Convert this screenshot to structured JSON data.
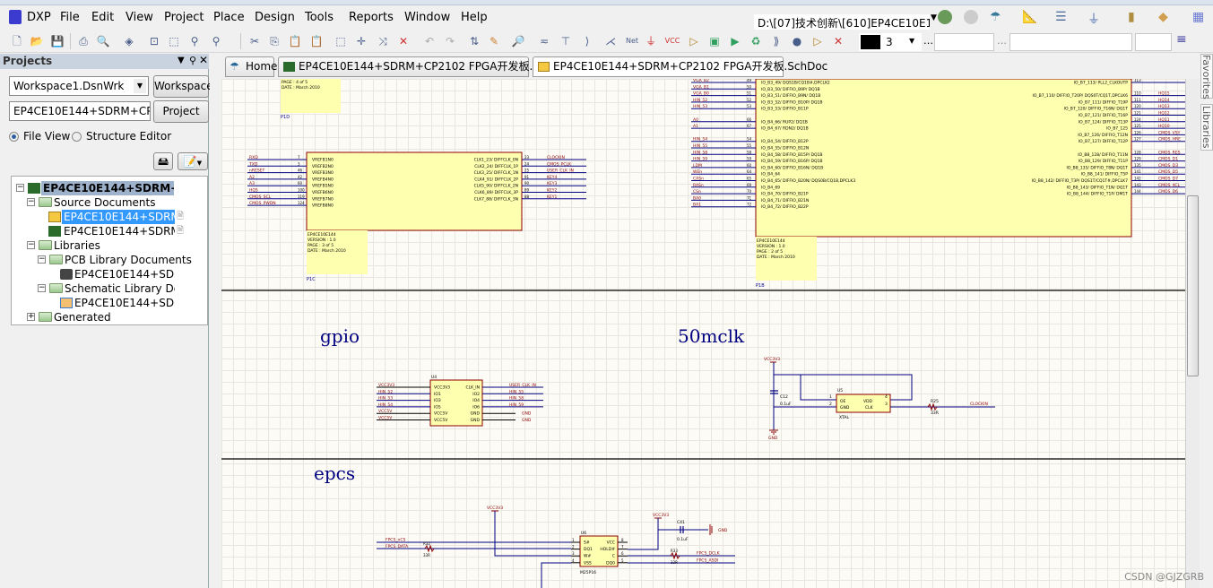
{
  "menu": {
    "logo": "DXP",
    "items": [
      "File",
      "Edit",
      "View",
      "Project",
      "Place",
      "Design",
      "Tools",
      "Reports",
      "Window",
      "Help"
    ]
  },
  "toolbar": {
    "path": "D:\\[07]技术创新\\[610]EP4CE10E1:",
    "line_width": "3",
    "net_label": "Net",
    "vcc_label": "VCC",
    "color": "#000000"
  },
  "panel": {
    "title": "Projects",
    "workspace_value": "Workspace1.DsnWrk",
    "workspace_btn": "Workspace",
    "project_value": "EP4CE10E144+SDRM+CP2102",
    "project_btn": "Project",
    "file_view": "File View",
    "structure_editor": "Structure Editor",
    "tree": {
      "root": "EP4CE10E144+SDRM+CP",
      "source_docs": "Source Documents",
      "sch_doc": "EP4CE10E144+SDRM+C",
      "pcb_doc": "EP4CE10E144+SDRM+C",
      "libraries": "Libraries",
      "pcb_lib_docs": "PCB Library Documents",
      "pcb_lib": "EP4CE10E144+SDRM",
      "sch_lib_docs": "Schematic Library Docum",
      "sch_lib": "EP4CE10E144+SDRM",
      "generated": "Generated"
    }
  },
  "tabs": [
    {
      "label": "Home"
    },
    {
      "label": "EP4CE10E144+SDRM+CP2102 FPGA开发板.PcbDoc"
    },
    {
      "label": "EP4CE10E144+SDRM+CP2102 FPGA开发板.SchDoc"
    }
  ],
  "right_panels": [
    "Favorites",
    "Libraries"
  ],
  "watermark": "CSDN @GJZGRB",
  "schematic": {
    "sections": {
      "gpio": "gpio",
      "mclk": "50mclk",
      "epcs": "epcs"
    },
    "p1d": {
      "page": "PAGE : 4 of 5",
      "date": "DATE : March 2010",
      "ref": "P1D"
    },
    "p1c": {
      "ref": "P1C",
      "title": [
        "EP4CE10E144",
        "VERSION : 1.0",
        "PAGE : 3 of 5",
        "DATE : March 2010"
      ],
      "left": [
        [
          "RXD",
          "7",
          "VREFB1N0"
        ],
        [
          "TXD",
          "3",
          "VREFB2N0"
        ],
        [
          "nRESET",
          "46",
          "VREFB3N0"
        ],
        [
          "A2",
          "42",
          "VREFB4N0"
        ],
        [
          "A3",
          "60",
          "VREFB5N0"
        ],
        [
          "HQ5",
          "100",
          "VREFB6N0"
        ],
        [
          "CMOS_SCL",
          "119",
          "VREFB7N0"
        ],
        [
          "CMOS_PWDN",
          "124",
          "VREFB8N0"
        ]
      ],
      "right": [
        [
          "CLOCKIN",
          "23",
          "CLK1_23/  DIFFCLK_0N"
        ],
        [
          "CMOS_PCLK",
          "24",
          "CLK2_24/  DIFFCLK_1P"
        ],
        [
          "USER_CLK_IN",
          "25",
          "CLK3_25/  DIFFCLK_1N"
        ],
        [
          "KEY4",
          "91",
          "CLK4_91/  DIFFCLK_2P"
        ],
        [
          "KEY3",
          "90",
          "CLK5_90/  DIFFCLK_2N"
        ],
        [
          "KEY2",
          "89",
          "CLK6_89/  DIFFCLK_3P"
        ],
        [
          "KEY1",
          "88",
          "CLK7_88/  DIFFCLK_3N"
        ]
      ]
    },
    "p1b": {
      "ref": "P1B",
      "title": [
        "EP4CE10E144",
        "VERSION : 1.0",
        "PAGE : 2 of 5",
        "DATE : March 2010"
      ],
      "left": [
        [
          "VGA_B2",
          "49",
          "IO_B3_49/  DQS1B/CQ1B#,DPCLK2"
        ],
        [
          "VGA_B1",
          "50",
          "IO_B3_50/  DIFFIO_B9P/  DQ1B"
        ],
        [
          "VGA_B0",
          "51",
          "IO_B3_51/  DIFFIO_B9N/  DQ1B"
        ],
        [
          "HIN_52",
          "52",
          "IO_B3_52/  DIFFIO_B10P/  DQ1B"
        ],
        [
          "HIN_53",
          "53",
          "IO_B3_53/  DIFFIO_B11P"
        ],
        [
          "",
          "",
          ""
        ],
        [
          "A0",
          "66",
          "IO_B4_66/  RUP2/  DQ1B"
        ],
        [
          "A1",
          "67",
          "IO_B4_67/  RDN2/  DQ1B"
        ],
        [
          "",
          "",
          ""
        ],
        [
          "HIN_54",
          "54",
          "IO_B4_54/  DIFFIO_B12P"
        ],
        [
          "HIN_55",
          "55",
          "IO_B4_55/  DIFFIO_B12N"
        ],
        [
          "HIN_58",
          "58",
          "IO_B4_58/  DIFFIO_B15P/  DQ1B"
        ],
        [
          "HIN_59",
          "59",
          "IO_B4_59/  DIFFIO_B16P/  DQ1B"
        ],
        [
          "LDM",
          "60",
          "IO_B4_60/  DIFFIO_B16N/  DQ1B"
        ],
        [
          "WEn",
          "64",
          "IO_B4_64"
        ],
        [
          "CASn",
          "65",
          "IO_B4_65/  DIFFIO_B20N/  DQS0B/CQ1B,DPCLK3"
        ],
        [
          "RASn",
          "69",
          "IO_B4_69"
        ],
        [
          "CSn",
          "70",
          "IO_B4_70/  DIFFIO_B21P"
        ],
        [
          "BA0",
          "71",
          "IO_B4_71/  DIFFIO_B21N"
        ],
        [
          "BA1",
          "72",
          "IO_B4_72/  DIFFIO_B22P"
        ]
      ],
      "right": [
        [
          "",
          "113",
          "IO_B7_113/  PLL2_CLKOUTP"
        ],
        [
          "",
          "",
          ""
        ],
        [
          "HQ15",
          "110",
          "IO_B7_110/  DIFFIO_T20P/  DQS0T/CQ1T,DPCLK6"
        ],
        [
          "HQ14",
          "111",
          "IO_B7_111/  DIFFIO_T19P"
        ],
        [
          "HQ13",
          "120",
          "IO_B7_120/  DIFFIO_T16N/  DQ1T"
        ],
        [
          "HQ12",
          "121",
          "IO_B7_121/  DIFFIO_T16P"
        ],
        [
          "HQ11",
          "124",
          "IO_B7_124/  DIFFIO_T13P"
        ],
        [
          "HQ10",
          "125",
          "IO_B7_125"
        ],
        [
          "CMOS_VSY",
          "126",
          "IO_B7_126/  DIFFIO_T12N"
        ],
        [
          "CMOS_HRE",
          "127",
          "IO_B7_127/  DIFFIO_T12P"
        ],
        [
          "",
          "",
          ""
        ],
        [
          "CMOS_RES",
          "128",
          "IO_B8_128/  DIFFIO_T11N"
        ],
        [
          "CMOS_D1",
          "129",
          "IO_B8_129/  DIFFIO_T11P"
        ],
        [
          "CMOS_D3",
          "135",
          "IO_B8_135/  DIFFIO_T8N/  DQ1T"
        ],
        [
          "CMOS_D5",
          "141",
          "IO_B8_141/  DIFFIO_T5P"
        ],
        [
          "CMOS_D7",
          "142",
          "IO_B8_142/  DIFFIO_T3P/  DQS1T/CQ1T#,DPCLK7"
        ],
        [
          "CMOS_XCL",
          "143",
          "IO_B8_143/  DIFFIO_T1N/  DQ1T"
        ],
        [
          "CMOS_D6",
          "144",
          "IO_B8_144/  DIFFIO_T1P/  DM1T"
        ]
      ]
    },
    "u4": {
      "ref": "U4",
      "left": [
        [
          "VCC3V3",
          "VCC3V3"
        ],
        [
          "HIN_52",
          "IO1"
        ],
        [
          "HIN_53",
          "IO3"
        ],
        [
          "HIN_54",
          "IO5"
        ],
        [
          "VCC5V",
          "VCC5V"
        ],
        [
          "VCC5V",
          "VCC5V"
        ]
      ],
      "right": [
        [
          "USER_CLK_IN",
          "CLK_IN"
        ],
        [
          "HIN_55",
          "IO2"
        ],
        [
          "HIN_58",
          "IO4"
        ],
        [
          "HIN_59",
          "IO6"
        ],
        [
          "GND",
          "GND"
        ],
        [
          "GND",
          "GND"
        ]
      ]
    },
    "u5": {
      "ref": "U5",
      "name": "XTAL",
      "pins": [
        "OE",
        "VDD",
        "GND",
        "CLK"
      ],
      "nums": [
        "1",
        "4",
        "2",
        "3"
      ],
      "vcc": "VCC3V3",
      "cap": "C12",
      "cap_val": "0.1uF",
      "gnd": "GND",
      "res": "R25",
      "res_val": "33R",
      "net": "CLOCKIN"
    },
    "u6": {
      "ref": "U6",
      "name": "M25P16",
      "left": [
        [
          "FPCS_nCS",
          "1",
          "S#"
        ],
        [
          "FPCS_DATA",
          "2",
          "DQ1"
        ],
        [
          "",
          "3",
          "W#"
        ],
        [
          "",
          "4",
          "VSS"
        ]
      ],
      "right": [
        [
          "",
          "8",
          "VCC"
        ],
        [
          "",
          "7",
          "HOLD#"
        ],
        [
          "FPCS_DCLK",
          "6",
          "C"
        ],
        [
          "FPCS_ASDI",
          "5",
          "DQ0"
        ]
      ],
      "vcc1": "VCC3V3",
      "vcc2": "VCC3V3",
      "cap": "C41",
      "cap_val": "0.1uF",
      "gnd": "GND",
      "r1": "R32",
      "r1_val": "33R",
      "r2": "R33",
      "r2_val": "33R"
    }
  }
}
